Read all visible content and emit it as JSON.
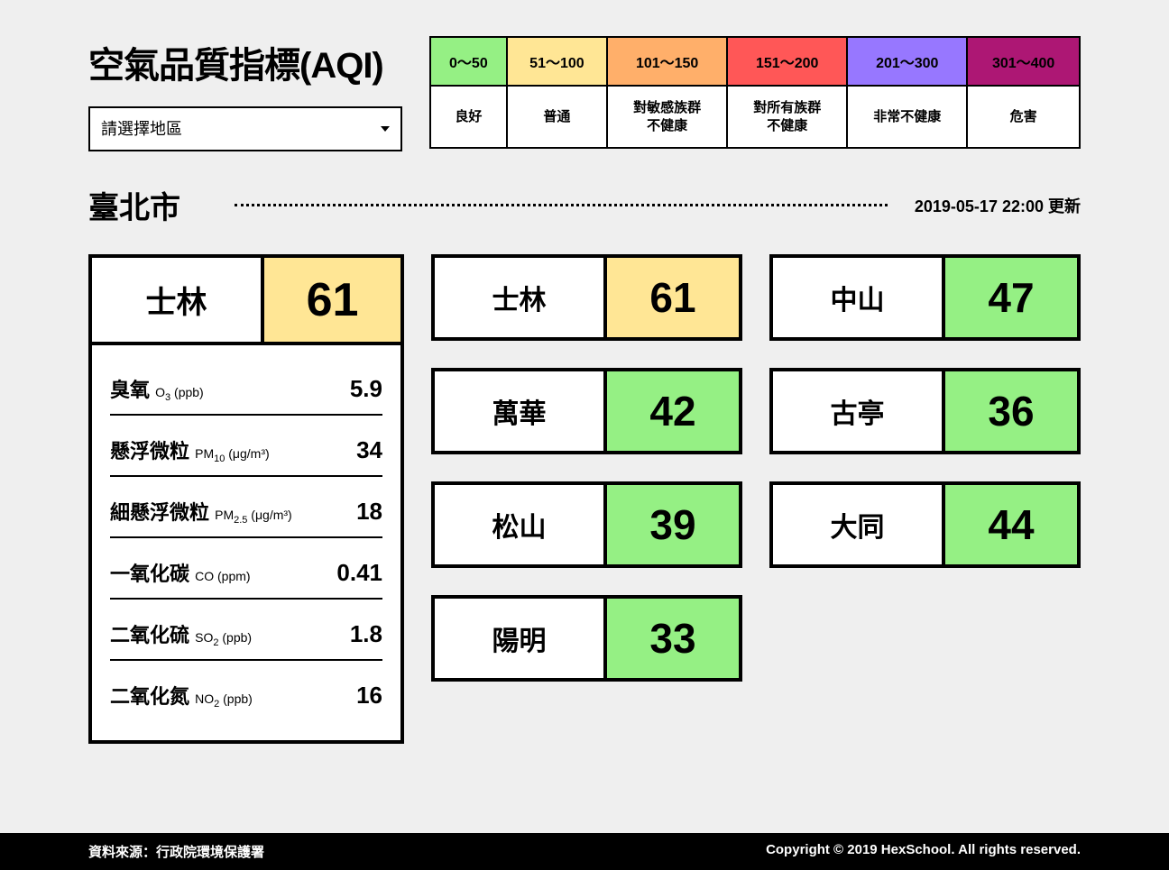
{
  "title": "空氣品質指標(AQI)",
  "select_placeholder": "請選擇地區",
  "legend": {
    "ranges": [
      "0～50",
      "51～100",
      "101～150",
      "151～200",
      "201～300",
      "301～400"
    ],
    "labels": [
      "良好",
      "普通",
      "對敏感族群\n不健康",
      "對所有族群\n不健康",
      "非常不健康",
      "危害"
    ],
    "colors": [
      "#95F084",
      "#FFE695",
      "#FFAF6A",
      "#FF5757",
      "#9777FF",
      "#AD1774"
    ]
  },
  "city": "臺北市",
  "update": "2019-05-17 22:00 更新",
  "detail": {
    "site": "士林",
    "aqi": 61,
    "aqi_color": "#FFE695",
    "metrics": [
      {
        "name": "臭氧",
        "unit_html": "O<sub class='sub'>3</sub> (ppb)",
        "value": "5.9"
      },
      {
        "name": "懸浮微粒",
        "unit_html": "PM<sub class='sub'>10</sub> (μg/m³)",
        "value": "34"
      },
      {
        "name": "細懸浮微粒",
        "unit_html": "PM<sub class='sub'>2.5</sub> (μg/m³)",
        "value": "18"
      },
      {
        "name": "一氧化碳",
        "unit_html": "CO (ppm)",
        "value": "0.41"
      },
      {
        "name": "二氧化硫",
        "unit_html": "SO<sub class='sub'>2</sub> (ppb)",
        "value": "1.8"
      },
      {
        "name": "二氧化氮",
        "unit_html": "NO<sub class='sub'>2</sub> (ppb)",
        "value": "16"
      }
    ]
  },
  "sites": [
    {
      "name": "士林",
      "aqi": 61,
      "color": "#FFE695"
    },
    {
      "name": "中山",
      "aqi": 47,
      "color": "#95F084"
    },
    {
      "name": "萬華",
      "aqi": 42,
      "color": "#95F084"
    },
    {
      "name": "古亭",
      "aqi": 36,
      "color": "#95F084"
    },
    {
      "name": "松山",
      "aqi": 39,
      "color": "#95F084"
    },
    {
      "name": "大同",
      "aqi": 44,
      "color": "#95F084"
    },
    {
      "name": "陽明",
      "aqi": 33,
      "color": "#95F084"
    }
  ],
  "footer": {
    "source": "資料來源：行政院環境保護署",
    "copyright": "Copyright © 2019 HexSchool. All rights reserved."
  }
}
